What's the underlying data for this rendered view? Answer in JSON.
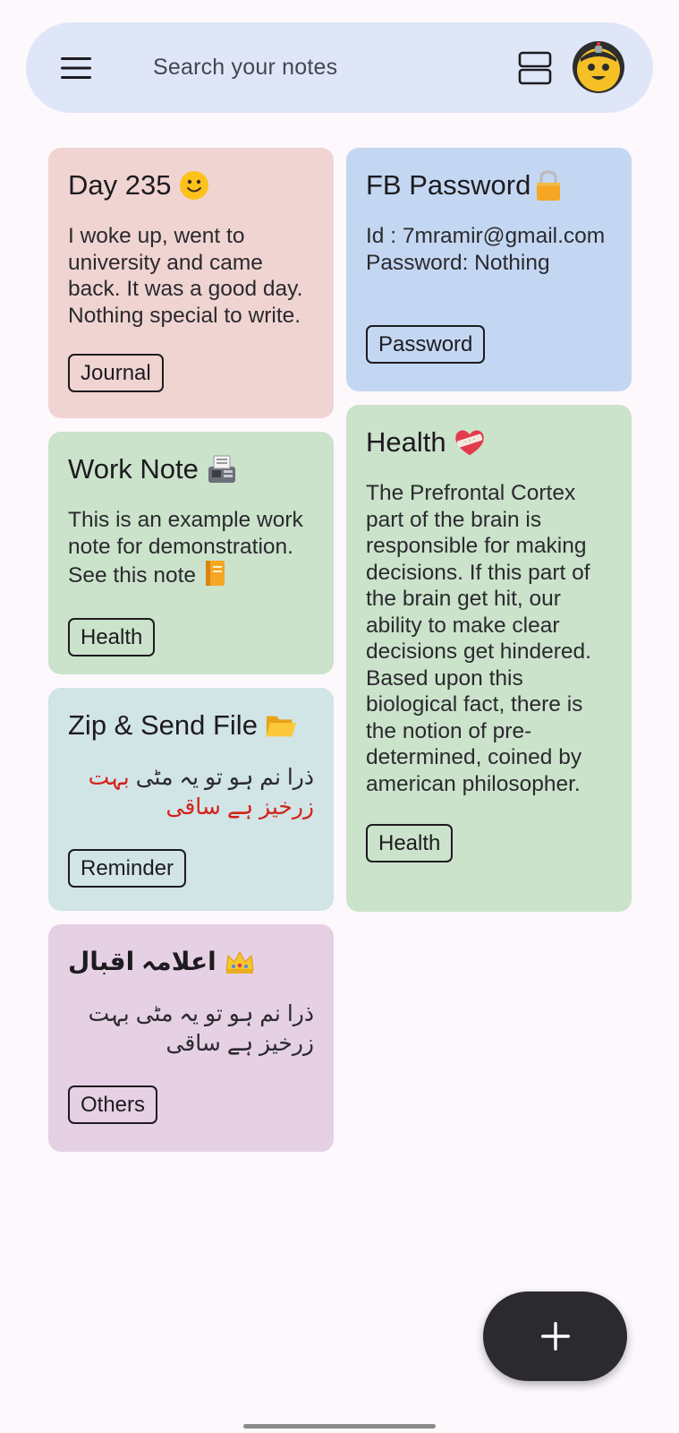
{
  "search": {
    "placeholder": "Search your notes"
  },
  "icons": {
    "menu": "hamburger-menu-icon",
    "layout": "view-agenda-icon",
    "avatar": "robot-avatar-icon",
    "add": "plus-icon"
  },
  "notes_left": [
    {
      "title": "Day 235",
      "emoji": "slightly-smiling-face-emoji",
      "body": "I woke up, went to university and came back. It was a good day. Nothing special to write.",
      "tag": "Journal",
      "color": "#f0d4d2"
    },
    {
      "title": "Work Note",
      "emoji": "fax-machine-emoji",
      "body": "This is an example work note for demonstration. See this note",
      "body_emoji": "notebook-emoji",
      "tag": "Health",
      "color": "#cbe2cb"
    },
    {
      "title": "Zip & Send File",
      "emoji": "open-folder-emoji",
      "body_plain": "ذرا نم ہو تو یہ مٹی",
      "body_red": "بہت زرخیز ہے ساقی",
      "tag": "Reminder",
      "color": "#d1e4e6"
    },
    {
      "title": "اعلامہ اقبال",
      "emoji": "crown-emoji",
      "body": "ذرا نم ہو تو یہ مٹی بہت زرخیز ہے ساقی",
      "tag": "Others",
      "color": "#e6d0e4"
    }
  ],
  "notes_right": [
    {
      "title": "FB Password",
      "emoji": "lock-emoji",
      "body_line1": "Id : 7mramir@gmail.com",
      "body_line2": "Password: Nothing",
      "tag": "Password",
      "color": "#c4d7f2"
    },
    {
      "title": "Health",
      "emoji": "mending-heart-emoji",
      "body": "The Prefrontal Cortex part of the brain is responsible for making decisions. If this part of the brain get hit, our ability to make clear decisions get hindered. Based upon this biological fact, there is the notion of pre-determined, coined by american philosopher.",
      "tag": "Health",
      "color": "#cbe2cb"
    }
  ]
}
